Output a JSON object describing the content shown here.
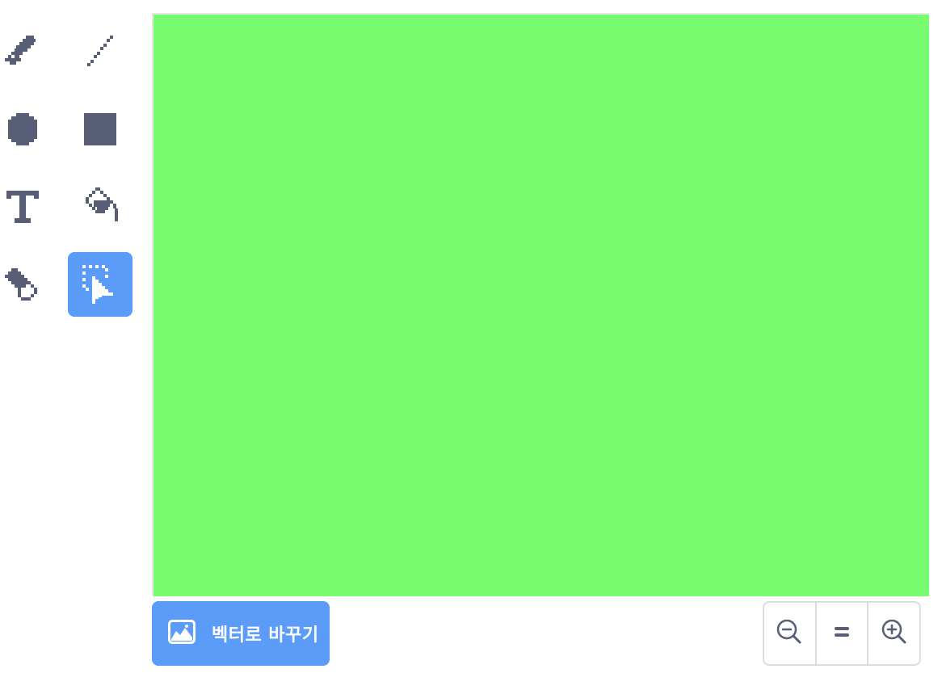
{
  "toolbar": {
    "tools": [
      {
        "name": "brush",
        "icon": "brush-icon",
        "selected": false
      },
      {
        "name": "line",
        "icon": "line-icon",
        "selected": false
      },
      {
        "name": "circle",
        "icon": "circle-icon",
        "selected": false
      },
      {
        "name": "rectangle",
        "icon": "rectangle-icon",
        "selected": false
      },
      {
        "name": "text",
        "icon": "text-icon",
        "selected": false
      },
      {
        "name": "fill",
        "icon": "fill-bucket-icon",
        "selected": false
      },
      {
        "name": "eraser",
        "icon": "eraser-icon",
        "selected": false
      },
      {
        "name": "select",
        "icon": "select-icon",
        "selected": true
      }
    ]
  },
  "canvas": {
    "fill_color": "#78fc70"
  },
  "convert_button": {
    "label": "벡터로 바꾸기",
    "icon": "bitmap-image-icon"
  },
  "zoom": {
    "zoom_out_icon": "zoom-out-icon",
    "reset_icon": "zoom-reset-icon",
    "zoom_in_icon": "zoom-in-icon"
  },
  "colors": {
    "accent": "#5b9cf9",
    "icon": "#575e75",
    "border": "#d9dde3"
  }
}
